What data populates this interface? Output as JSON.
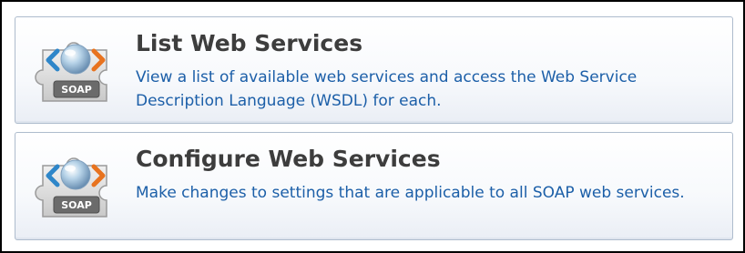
{
  "panels": [
    {
      "title": "List Web Services",
      "description": "View a list of available web services and access the Web Service Description Language (WSDL) for each.",
      "icon": "soap-web-service-icon",
      "icon_label": "SOAP"
    },
    {
      "title": "Configure Web Services",
      "description": "Make changes to settings that are applicable to all SOAP web services.",
      "icon": "soap-web-service-icon",
      "icon_label": "SOAP"
    }
  ],
  "colors": {
    "title": "#3d3d3d",
    "description": "#1c5fa8",
    "panel_border": "#aebccd",
    "frame_border": "#000000"
  }
}
